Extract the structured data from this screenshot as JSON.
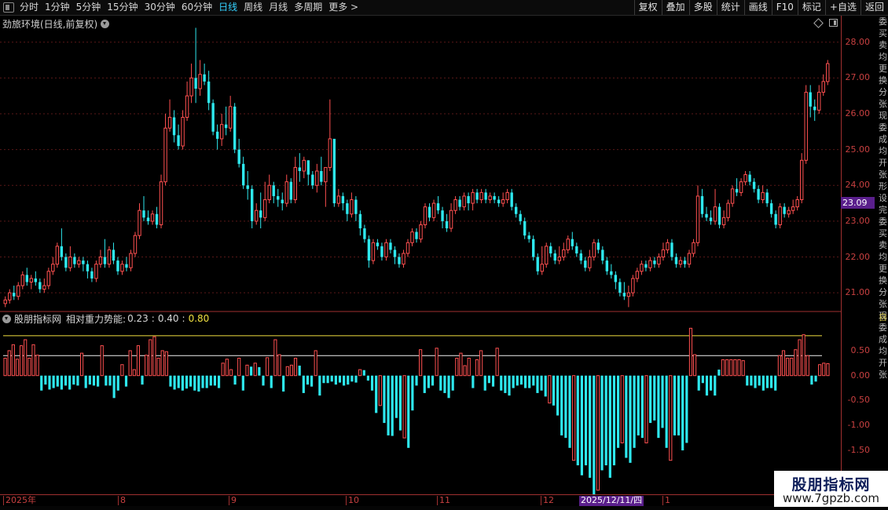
{
  "toolbar": {
    "periods": [
      "分时",
      "1分钟",
      "5分钟",
      "15分钟",
      "30分钟",
      "60分钟",
      "日线",
      "周线",
      "月线",
      "多周期",
      "更多 >"
    ],
    "active_period": "日线",
    "right_buttons": [
      "复权",
      "叠加",
      "多股",
      "统计",
      "画线",
      "F10",
      "标记",
      "+自选",
      "返回"
    ]
  },
  "kline": {
    "title": "劲旅环境(日线,前复权)",
    "price_ticks": [
      "28.00",
      "27.00",
      "26.00",
      "25.00",
      "24.00",
      "23.00",
      "22.00",
      "21.00"
    ],
    "current_price": "23.09"
  },
  "indicator": {
    "name": "股朋指标网",
    "label": "相对重力势能:",
    "value1": "0.23",
    "sep": ":",
    "value2": "0.40",
    "value3": "0.80",
    "ticks": [
      "0.50",
      "0.00",
      "-0.50",
      "-1.00",
      "-1.50",
      "-2.00"
    ],
    "colors": {
      "up": "#ff5050",
      "down": "#2ee8ee",
      "line_yellow": "#f0e040",
      "line_white": "#f0f0f0"
    }
  },
  "xaxis": {
    "labels": [
      "2025年",
      "8",
      "9",
      "10",
      "11",
      "12",
      "1"
    ],
    "selected_date": "2025/12/11/四"
  },
  "right_strip": {
    "text": "委买卖均更换分张现委成均开张形设完委买卖均更换分张现委成均开张",
    "indicator_label": "自"
  },
  "watermark": {
    "title": "股朋指标网",
    "url": "www.7gpzb.com"
  },
  "chart_data": {
    "type": "candlestick",
    "price_range": [
      20.5,
      28.3
    ],
    "candles": [
      [
        20.7,
        20.8,
        20.6,
        20.9
      ],
      [
        20.8,
        21.0,
        20.7,
        21.1
      ],
      [
        21.0,
        20.9,
        20.8,
        21.2
      ],
      [
        20.9,
        21.2,
        20.8,
        21.3
      ],
      [
        21.2,
        21.5,
        21.1,
        21.6
      ],
      [
        21.5,
        21.3,
        21.2,
        21.7
      ],
      [
        21.3,
        21.4,
        21.1,
        21.5
      ],
      [
        21.4,
        21.3,
        21.2,
        21.6
      ],
      [
        21.3,
        21.1,
        21.0,
        21.4
      ],
      [
        21.1,
        21.2,
        21.0,
        21.4
      ],
      [
        21.2,
        21.6,
        21.1,
        21.7
      ],
      [
        21.6,
        21.8,
        21.5,
        22.0
      ],
      [
        21.8,
        22.3,
        21.7,
        22.4
      ],
      [
        22.3,
        22.0,
        21.9,
        22.8
      ],
      [
        22.0,
        21.7,
        21.6,
        22.1
      ],
      [
        21.7,
        22.0,
        21.6,
        22.3
      ],
      [
        22.0,
        21.8,
        21.7,
        22.1
      ],
      [
        21.8,
        21.9,
        21.7,
        22.0
      ],
      [
        21.9,
        21.8,
        21.6,
        22.0
      ],
      [
        21.8,
        21.6,
        21.4,
        21.9
      ],
      [
        21.6,
        21.4,
        21.3,
        21.7
      ],
      [
        21.4,
        21.8,
        21.3,
        21.9
      ],
      [
        21.8,
        22.0,
        21.7,
        22.2
      ],
      [
        22.0,
        21.8,
        21.7,
        22.5
      ],
      [
        21.8,
        22.2,
        21.7,
        22.3
      ],
      [
        22.2,
        21.9,
        21.8,
        22.4
      ],
      [
        21.9,
        21.6,
        21.5,
        22.0
      ],
      [
        21.6,
        21.8,
        21.5,
        21.9
      ],
      [
        21.8,
        21.7,
        21.6,
        22.0
      ],
      [
        21.7,
        22.1,
        21.6,
        22.2
      ],
      [
        22.1,
        22.6,
        22.0,
        22.7
      ],
      [
        22.6,
        23.3,
        22.5,
        23.5
      ],
      [
        23.3,
        23.1,
        23.0,
        23.7
      ],
      [
        23.1,
        23.0,
        22.9,
        23.3
      ],
      [
        23.0,
        23.2,
        22.9,
        23.3
      ],
      [
        23.2,
        22.9,
        22.8,
        23.4
      ],
      [
        22.9,
        24.1,
        22.8,
        24.3
      ],
      [
        24.1,
        25.6,
        24.0,
        26.0
      ],
      [
        25.6,
        25.9,
        25.5,
        26.4
      ],
      [
        25.9,
        25.4,
        25.2,
        26.1
      ],
      [
        25.4,
        25.1,
        25.0,
        25.7
      ],
      [
        25.1,
        25.9,
        25.0,
        26.1
      ],
      [
        25.9,
        26.5,
        25.8,
        26.9
      ],
      [
        26.5,
        27.0,
        26.3,
        27.4
      ],
      [
        27.0,
        26.7,
        26.3,
        28.4
      ],
      [
        26.7,
        27.1,
        26.5,
        27.5
      ],
      [
        27.1,
        26.9,
        26.8,
        27.4
      ],
      [
        26.9,
        26.3,
        26.1,
        27.2
      ],
      [
        26.3,
        25.5,
        25.4,
        26.4
      ],
      [
        25.5,
        25.3,
        25.0,
        25.7
      ],
      [
        25.3,
        25.7,
        25.1,
        26.0
      ],
      [
        25.7,
        25.6,
        25.4,
        26.2
      ],
      [
        25.6,
        26.2,
        25.5,
        26.5
      ],
      [
        26.2,
        25.0,
        24.9,
        26.3
      ],
      [
        25.0,
        24.6,
        24.5,
        25.3
      ],
      [
        24.6,
        24.0,
        23.9,
        24.8
      ],
      [
        24.0,
        23.9,
        23.6,
        24.4
      ],
      [
        23.9,
        23.0,
        22.8,
        24.0
      ],
      [
        23.0,
        23.3,
        22.9,
        23.5
      ],
      [
        23.3,
        23.1,
        22.8,
        23.8
      ],
      [
        23.1,
        23.6,
        23.0,
        24.1
      ],
      [
        23.6,
        24.0,
        23.5,
        24.3
      ],
      [
        24.0,
        23.7,
        23.5,
        24.1
      ],
      [
        23.7,
        23.6,
        23.4,
        23.9
      ],
      [
        23.6,
        23.5,
        23.3,
        23.8
      ],
      [
        23.5,
        24.1,
        23.4,
        24.3
      ],
      [
        24.1,
        23.6,
        23.5,
        24.2
      ],
      [
        23.6,
        24.5,
        23.5,
        24.8
      ],
      [
        24.5,
        24.4,
        24.1,
        24.9
      ],
      [
        24.4,
        24.7,
        24.2,
        24.8
      ],
      [
        24.7,
        24.3,
        24.0,
        24.7
      ],
      [
        24.3,
        24.0,
        23.9,
        24.4
      ],
      [
        24.0,
        24.4,
        23.8,
        24.6
      ],
      [
        24.4,
        24.1,
        24.0,
        24.8
      ],
      [
        24.1,
        24.5,
        23.4,
        24.5
      ],
      [
        24.5,
        25.3,
        24.4,
        26.4
      ],
      [
        25.3,
        23.5,
        23.4,
        25.2
      ],
      [
        23.5,
        23.7,
        23.4,
        23.9
      ],
      [
        23.7,
        23.5,
        23.3,
        23.8
      ],
      [
        23.5,
        23.2,
        23.0,
        23.6
      ],
      [
        23.2,
        23.6,
        23.1,
        23.8
      ],
      [
        23.6,
        23.2,
        23.0,
        23.7
      ],
      [
        23.2,
        22.8,
        22.6,
        23.3
      ],
      [
        22.8,
        22.5,
        22.4,
        22.9
      ],
      [
        22.5,
        21.9,
        21.7,
        22.6
      ],
      [
        21.9,
        22.4,
        21.8,
        22.5
      ],
      [
        22.4,
        22.3,
        22.2,
        22.5
      ],
      [
        22.3,
        22.0,
        21.9,
        22.4
      ],
      [
        22.0,
        22.4,
        21.9,
        22.5
      ],
      [
        22.4,
        22.2,
        22.1,
        22.5
      ],
      [
        22.2,
        22.0,
        21.8,
        22.3
      ],
      [
        22.0,
        21.8,
        21.7,
        22.1
      ],
      [
        21.8,
        22.1,
        21.7,
        22.2
      ],
      [
        22.1,
        22.4,
        22.0,
        22.5
      ],
      [
        22.4,
        22.7,
        22.3,
        22.8
      ],
      [
        22.7,
        22.5,
        22.4,
        22.8
      ],
      [
        22.5,
        22.9,
        22.4,
        23.0
      ],
      [
        22.9,
        23.4,
        22.8,
        23.5
      ],
      [
        23.4,
        23.1,
        23.0,
        23.5
      ],
      [
        23.1,
        23.5,
        23.0,
        23.6
      ],
      [
        23.5,
        23.3,
        23.2,
        23.7
      ],
      [
        23.3,
        23.0,
        22.8,
        23.4
      ],
      [
        23.0,
        22.8,
        22.7,
        23.2
      ],
      [
        22.8,
        23.3,
        22.7,
        23.5
      ],
      [
        23.3,
        23.6,
        23.2,
        23.7
      ],
      [
        23.6,
        23.4,
        23.3,
        23.7
      ],
      [
        23.4,
        23.7,
        23.3,
        23.8
      ],
      [
        23.7,
        23.5,
        23.3,
        23.8
      ],
      [
        23.5,
        23.8,
        23.3,
        23.9
      ],
      [
        23.8,
        23.6,
        23.5,
        23.9
      ],
      [
        23.6,
        23.8,
        23.5,
        23.9
      ],
      [
        23.8,
        23.6,
        23.5,
        23.9
      ],
      [
        23.6,
        23.7,
        23.5,
        23.8
      ],
      [
        23.7,
        23.6,
        23.5,
        23.8
      ],
      [
        23.6,
        23.5,
        23.4,
        23.7
      ],
      [
        23.5,
        23.6,
        23.4,
        23.8
      ],
      [
        23.6,
        23.8,
        23.5,
        23.9
      ],
      [
        23.8,
        23.4,
        23.3,
        23.9
      ],
      [
        23.4,
        23.2,
        23.1,
        23.5
      ],
      [
        23.2,
        23.0,
        22.9,
        23.3
      ],
      [
        23.0,
        22.6,
        22.5,
        23.1
      ],
      [
        22.6,
        22.5,
        22.4,
        22.7
      ],
      [
        22.5,
        22.0,
        21.9,
        22.6
      ],
      [
        22.0,
        21.6,
        21.5,
        22.1
      ],
      [
        21.6,
        21.8,
        21.5,
        22.3
      ],
      [
        21.8,
        22.3,
        21.7,
        22.4
      ],
      [
        22.3,
        22.1,
        22.0,
        22.4
      ],
      [
        22.1,
        21.9,
        21.8,
        22.2
      ],
      [
        21.9,
        22.0,
        21.8,
        22.3
      ],
      [
        22.0,
        22.2,
        21.9,
        22.4
      ],
      [
        22.2,
        22.5,
        22.1,
        22.6
      ],
      [
        22.5,
        22.3,
        22.2,
        22.7
      ],
      [
        22.3,
        22.1,
        22.0,
        22.4
      ],
      [
        22.1,
        21.9,
        21.8,
        22.2
      ],
      [
        21.9,
        21.7,
        21.6,
        22.0
      ],
      [
        21.7,
        22.0,
        21.6,
        22.2
      ],
      [
        22.0,
        22.4,
        21.9,
        22.5
      ],
      [
        22.4,
        22.2,
        22.1,
        22.5
      ],
      [
        22.2,
        21.9,
        21.8,
        22.3
      ],
      [
        21.9,
        21.6,
        21.5,
        22.0
      ],
      [
        21.6,
        21.5,
        21.4,
        21.8
      ],
      [
        21.5,
        21.3,
        21.1,
        21.6
      ],
      [
        21.3,
        21.0,
        20.9,
        21.4
      ],
      [
        21.0,
        20.9,
        20.8,
        21.3
      ],
      [
        20.9,
        21.0,
        20.6,
        21.2
      ],
      [
        21.0,
        21.4,
        20.9,
        21.5
      ],
      [
        21.4,
        21.6,
        21.3,
        21.7
      ],
      [
        21.6,
        21.8,
        21.5,
        21.9
      ],
      [
        21.8,
        21.7,
        21.6,
        21.9
      ],
      [
        21.7,
        21.9,
        21.6,
        22.0
      ],
      [
        21.9,
        21.8,
        21.7,
        22.0
      ],
      [
        21.8,
        22.0,
        21.7,
        22.1
      ],
      [
        22.0,
        22.2,
        21.9,
        22.4
      ],
      [
        22.2,
        22.4,
        22.1,
        22.5
      ],
      [
        22.4,
        22.0,
        21.9,
        22.5
      ],
      [
        22.0,
        21.8,
        21.7,
        22.1
      ],
      [
        21.8,
        21.9,
        21.7,
        22.0
      ],
      [
        21.9,
        21.8,
        21.7,
        22.0
      ],
      [
        21.8,
        22.1,
        21.7,
        22.2
      ],
      [
        22.1,
        22.4,
        22.0,
        22.5
      ],
      [
        22.4,
        23.7,
        22.3,
        24.0
      ],
      [
        23.7,
        23.2,
        23.1,
        23.9
      ],
      [
        23.2,
        23.1,
        23.0,
        23.4
      ],
      [
        23.1,
        23.0,
        22.9,
        23.3
      ],
      [
        23.0,
        23.4,
        22.9,
        23.9
      ],
      [
        23.4,
        22.9,
        22.8,
        23.5
      ],
      [
        22.9,
        23.1,
        22.8,
        23.3
      ],
      [
        23.1,
        23.5,
        23.0,
        23.6
      ],
      [
        23.5,
        23.9,
        23.4,
        24.0
      ],
      [
        23.9,
        23.8,
        23.7,
        24.2
      ],
      [
        23.8,
        24.1,
        23.7,
        24.2
      ],
      [
        24.1,
        24.3,
        24.0,
        24.4
      ],
      [
        24.3,
        24.1,
        24.0,
        24.4
      ],
      [
        24.1,
        23.9,
        23.8,
        24.2
      ],
      [
        23.9,
        23.6,
        23.5,
        24.0
      ],
      [
        23.6,
        23.8,
        23.5,
        24.0
      ],
      [
        23.8,
        23.5,
        23.4,
        23.9
      ],
      [
        23.5,
        23.2,
        23.1,
        23.6
      ],
      [
        23.2,
        22.9,
        22.8,
        23.3
      ],
      [
        22.9,
        23.4,
        22.8,
        23.5
      ],
      [
        23.4,
        23.2,
        23.1,
        23.5
      ],
      [
        23.2,
        23.3,
        23.1,
        23.4
      ],
      [
        23.3,
        23.4,
        23.2,
        23.6
      ],
      [
        23.4,
        23.6,
        23.3,
        23.7
      ],
      [
        23.6,
        24.7,
        23.5,
        24.9
      ],
      [
        24.7,
        26.6,
        24.6,
        26.8
      ],
      [
        26.6,
        26.2,
        25.9,
        26.8
      ],
      [
        26.2,
        26.1,
        25.8,
        26.4
      ],
      [
        26.1,
        26.6,
        26.0,
        26.8
      ],
      [
        26.6,
        26.9,
        26.5,
        27.1
      ],
      [
        26.9,
        27.4,
        26.8,
        27.5
      ]
    ],
    "indicator_values": [
      0.35,
      0.5,
      0.62,
      0.33,
      0.6,
      0.72,
      0.35,
      0.62,
      0.41,
      -0.3,
      -0.18,
      -0.28,
      -0.25,
      -0.22,
      -0.28,
      -0.2,
      -0.28,
      -0.18,
      -0.2,
      0.45,
      -0.25,
      -0.18,
      -0.2,
      -0.22,
      0.6,
      -0.2,
      -0.2,
      -0.45,
      -0.3,
      0.22,
      -0.22,
      0.5,
      0.12,
      0.6,
      -0.18,
      0.41,
      0.72,
      0.78,
      0.35,
      0.5,
      0.48,
      -0.22,
      -0.28,
      -0.25,
      -0.3,
      -0.26,
      -0.22,
      -0.3,
      -0.32,
      -0.25,
      -0.25,
      -0.2,
      -0.2,
      -0.25,
      0.25,
      0.33,
      0.12,
      -0.18,
      0.35,
      -0.3,
      0.21,
      0.18,
      0.25,
      0.17,
      -0.2,
      0.36,
      -0.25,
      0.72,
      0.42,
      -0.32,
      0.18,
      0.21,
      0.35,
      0.2,
      -0.35,
      -0.18,
      -0.22,
      0.5,
      -0.4,
      -0.15,
      -0.15,
      -0.12,
      -0.18,
      -0.14,
      -0.2,
      -0.18,
      -0.12,
      -0.14,
      0.12,
      0.11,
      -0.1,
      -0.3,
      -0.75,
      -0.6,
      -0.95,
      -1.2,
      -1.21,
      -0.85,
      -1.1,
      -1.25,
      -1.45,
      -0.7,
      -0.2,
      0.52,
      -0.35,
      -0.25,
      -0.2,
      0.55,
      -0.3,
      -0.35,
      -0.45,
      -0.3,
      0.35,
      0.45,
      0.2,
      0.35,
      -0.25,
      0.32,
      0.5,
      -0.3,
      -0.15,
      -0.22,
      0.55,
      -0.3,
      -0.35,
      -0.4,
      -0.25,
      -0.2,
      -0.18,
      -0.25,
      -0.25,
      -0.2,
      -0.35,
      -0.3,
      -0.42,
      -0.55,
      -0.6,
      -0.8,
      -1.2,
      -1.25,
      -1.45,
      -1.7,
      -1.8,
      -2.0,
      -1.8,
      -2.05,
      -2.4,
      -2.3,
      -1.9,
      -1.8,
      -2.05,
      -1.8,
      -1.45,
      -1.35,
      -1.65,
      -1.75,
      -1.45,
      -1.2,
      -1.25,
      -1.35,
      -0.95,
      -0.9,
      -1.25,
      -1.05,
      -1.45,
      -1.7,
      -1.2,
      -1.2,
      -1.5,
      -1.35,
      0.95,
      0.42,
      -0.3,
      -0.15,
      -0.4,
      -0.3,
      -0.4,
      0.12,
      0.32,
      0.32,
      0.32,
      0.32,
      0.32,
      0.3,
      -0.2,
      -0.2,
      -0.25,
      -0.2,
      -0.3,
      -0.25,
      -0.25,
      -0.3,
      0.4,
      0.5,
      0.35,
      0.35,
      0.52,
      0.72,
      0.82,
      0.4,
      -0.18,
      -0.12,
      0.22,
      0.25,
      0.24
    ],
    "indicator_range": [
      -2.35,
      1.05
    ],
    "hlines": [
      0.8,
      0.4
    ]
  }
}
